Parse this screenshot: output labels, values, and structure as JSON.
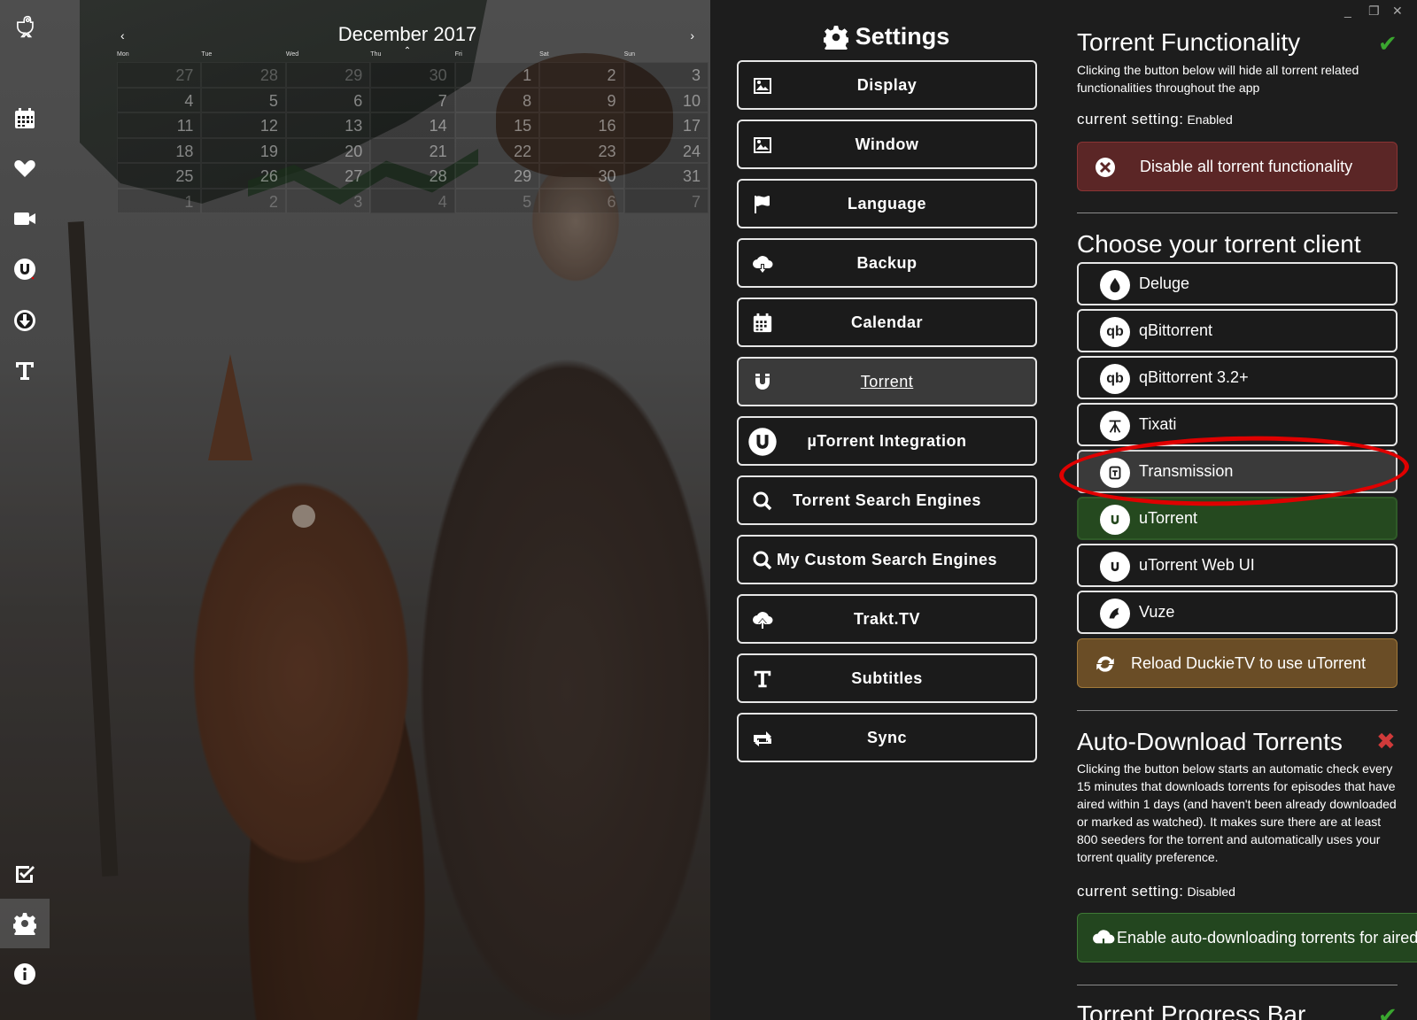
{
  "calendar": {
    "title": "December 2017",
    "prev": "‹",
    "next": "›",
    "caret": "⌃",
    "weekdays": [
      "Mon",
      "Tue",
      "Wed",
      "Thu",
      "Fri",
      "Sat",
      "Sun"
    ],
    "weeks": [
      [
        "27",
        "28",
        "29",
        "30",
        "1",
        "2",
        "3"
      ],
      [
        "4",
        "5",
        "6",
        "7",
        "8",
        "9",
        "10"
      ],
      [
        "11",
        "12",
        "13",
        "14",
        "15",
        "16",
        "17"
      ],
      [
        "18",
        "19",
        "20",
        "21",
        "22",
        "23",
        "24"
      ],
      [
        "25",
        "26",
        "27",
        "28",
        "29",
        "30",
        "31"
      ],
      [
        "1",
        "2",
        "3",
        "4",
        "5",
        "6",
        "7"
      ]
    ]
  },
  "sidebar": {
    "icons": [
      "duckie-logo-icon",
      "calendar-icon",
      "heart-icon",
      "video-camera-icon",
      "utorrent-icon",
      "download-icon",
      "subtitles-icon",
      "checkbox-icon",
      "gear-icon",
      "info-icon"
    ]
  },
  "settings": {
    "title": "Settings",
    "menu": [
      {
        "label": "Display",
        "icon": "image-icon"
      },
      {
        "label": "Window",
        "icon": "image-icon"
      },
      {
        "label": "Language",
        "icon": "flag-icon"
      },
      {
        "label": "Backup",
        "icon": "cloud-download-icon"
      },
      {
        "label": "Calendar",
        "icon": "calendar-icon"
      },
      {
        "label": "Torrent",
        "icon": "magnet-icon",
        "active": true
      },
      {
        "label": "µTorrent Integration",
        "icon": "utorrent-icon"
      },
      {
        "label": "Torrent Search Engines",
        "icon": "search-icon"
      },
      {
        "label": "My Custom Search Engines",
        "icon": "search-icon"
      },
      {
        "label": "Trakt.TV",
        "icon": "cloud-upload-icon"
      },
      {
        "label": "Subtitles",
        "icon": "subtitles-icon"
      },
      {
        "label": "Sync",
        "icon": "sync-icon"
      }
    ]
  },
  "torrent_functionality": {
    "title": "Torrent Functionality",
    "status_icon": "✔",
    "status_color": "#3aa62f",
    "description": "Clicking the button below will hide all torrent related functionalities throughout the app",
    "current_label": "current setting:",
    "current_value": "Enabled",
    "button": "Disable all torrent functionality"
  },
  "torrent_client": {
    "title": "Choose your torrent client",
    "clients": [
      {
        "label": "Deluge",
        "icon": "deluge-icon"
      },
      {
        "label": "qBittorrent",
        "icon": "qbittorrent-icon",
        "glyph": "qb"
      },
      {
        "label": "qBittorrent 3.2+",
        "icon": "qbittorrent-icon",
        "glyph": "qb"
      },
      {
        "label": "Tixati",
        "icon": "tixati-icon"
      },
      {
        "label": "Transmission",
        "icon": "transmission-icon",
        "selected": true
      },
      {
        "label": "uTorrent",
        "icon": "utorrent-icon",
        "current": true
      },
      {
        "label": "uTorrent Web UI",
        "icon": "utorrent-icon"
      },
      {
        "label": "Vuze",
        "icon": "vuze-icon"
      }
    ],
    "reload_button": "Reload DuckieTV to use uTorrent"
  },
  "auto_download": {
    "title": "Auto-Download Torrents",
    "status_icon": "✖",
    "status_color": "#d03a3a",
    "description": "Clicking the button below starts an automatic check every 15 minutes that downloads torrents for episodes that have aired within 1 days (and haven't been already downloaded or marked as watched). It makes sure there are at least 800 seeders for the torrent and automatically uses your torrent quality preference.",
    "current_label": "current setting:",
    "current_value": "Disabled",
    "button": "Enable auto-downloading torrents for aired episodes"
  },
  "progress_bar": {
    "title": "Torrent Progress Bar",
    "status_icon": "✔"
  },
  "window": {
    "minimize": "_",
    "restore": "❐",
    "close": "✕"
  },
  "colors": {
    "accent_green": "#3aa62f",
    "red_button": "#5b2626",
    "orange_button": "#6a4d26",
    "green_button": "#23461f",
    "highlight_ring": "#e00000"
  }
}
